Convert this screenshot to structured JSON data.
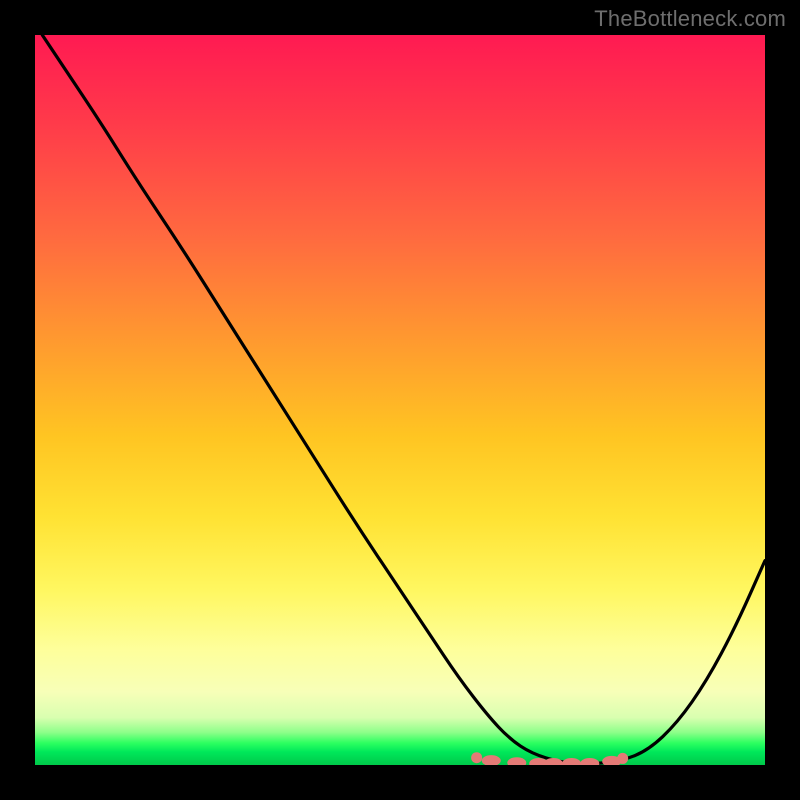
{
  "watermark": "TheBottleneck.com",
  "colors": {
    "gradient_top": "#ff1a52",
    "gradient_mid1": "#ff9a2f",
    "gradient_mid2": "#fff760",
    "gradient_bottom": "#00c84a",
    "curve": "#000000",
    "marker": "#e47a76",
    "frame": "#000000"
  },
  "chart_data": {
    "type": "line",
    "title": "",
    "xlabel": "",
    "ylabel": "",
    "xlim": [
      0,
      100
    ],
    "ylim": [
      0,
      100
    ],
    "grid": false,
    "legend_position": null,
    "description": "Bottleneck curve: a single V-shaped curve on a vertical heat gradient. Left arm descends steeply from top-left, reaches a wide flat minimum (~0 bottleneck) around x≈65–80, then rises on the right. A cluster of salmon-pink markers sits along the bottom of the valley.",
    "series": [
      {
        "name": "bottleneck-curve",
        "x": [
          1,
          4,
          9,
          14,
          20,
          26,
          32,
          38,
          44,
          50,
          54,
          58,
          62,
          65,
          68,
          72,
          76,
          80,
          84,
          88,
          92,
          96,
          100
        ],
        "y": [
          100,
          95.5,
          88,
          80,
          71,
          61.5,
          52,
          42.5,
          33,
          24,
          18,
          12,
          6.8,
          3.6,
          1.6,
          0.35,
          0.15,
          0.45,
          2.0,
          5.8,
          11.5,
          19,
          28
        ]
      }
    ],
    "markers": [
      {
        "x": 60.5,
        "y": 1.0
      },
      {
        "x": 62.5,
        "y": 0.6
      },
      {
        "x": 66.0,
        "y": 0.3
      },
      {
        "x": 69.0,
        "y": 0.2
      },
      {
        "x": 71.0,
        "y": 0.2
      },
      {
        "x": 73.5,
        "y": 0.2
      },
      {
        "x": 76.0,
        "y": 0.2
      },
      {
        "x": 79.0,
        "y": 0.5
      },
      {
        "x": 80.5,
        "y": 0.9
      }
    ]
  }
}
